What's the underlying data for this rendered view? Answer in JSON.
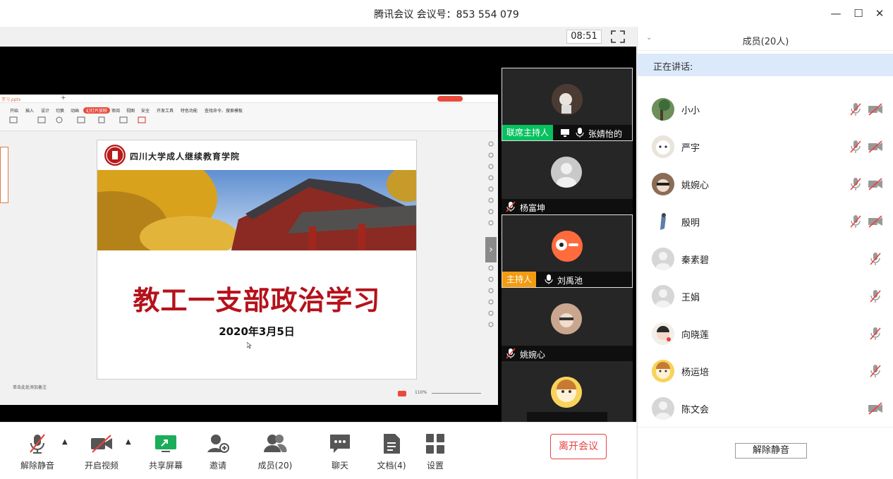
{
  "window": {
    "title": "腾讯会议 会议号：853 554 079",
    "minimize": "—",
    "maximize": "☐",
    "close": "✕"
  },
  "meeting": {
    "timer": "08:51"
  },
  "slide": {
    "org": "四川大学成人继续教育学院",
    "title": "教工一支部政治学习",
    "date": "2020年3月5日"
  },
  "ppt": {
    "filename": "学习.pptx",
    "tabs": [
      "开始",
      "插入",
      "设计",
      "切换",
      "动画",
      "幻灯片放映",
      "审阅",
      "视图",
      "安全",
      "开发工具",
      "特色功能",
      "查找命令、搜索模板"
    ],
    "active_tab_index": 5,
    "notes_hint": "单击此处添加备注",
    "zoom": "110%"
  },
  "video_tiles": [
    {
      "role": "联席主持人",
      "name": "张婧怡的屏..."
    },
    {
      "role": "",
      "name": "杨富坤"
    },
    {
      "role": "主持人",
      "name": "刘禹池"
    },
    {
      "role": "",
      "name": "姚婉心"
    },
    {
      "role": "",
      "name": ""
    }
  ],
  "toolbar": {
    "unmute": "解除静音",
    "video": "开启视频",
    "share": "共享屏幕",
    "invite": "邀请",
    "members": "成员(20)",
    "chat": "聊天",
    "docs": "文档(4)",
    "settings": "设置",
    "leave": "离开会议"
  },
  "panel": {
    "title": "成员(20人)",
    "speaking_label": "正在讲话:",
    "members": [
      {
        "name": "小小"
      },
      {
        "name": "严宇"
      },
      {
        "name": "姚婉心"
      },
      {
        "name": "殷明"
      },
      {
        "name": "秦素碧"
      },
      {
        "name": "王娟"
      },
      {
        "name": "向晓莲"
      },
      {
        "name": "杨运培"
      },
      {
        "name": "陈文会"
      }
    ],
    "unmute_all": "解除静音"
  },
  "colors": {
    "leave": "#e64340",
    "cohost": "#07c160",
    "host": "#f39c12",
    "slide_title": "#b5121b",
    "speaking_bg": "#dce9fb",
    "share_active": "#1aad5a"
  }
}
